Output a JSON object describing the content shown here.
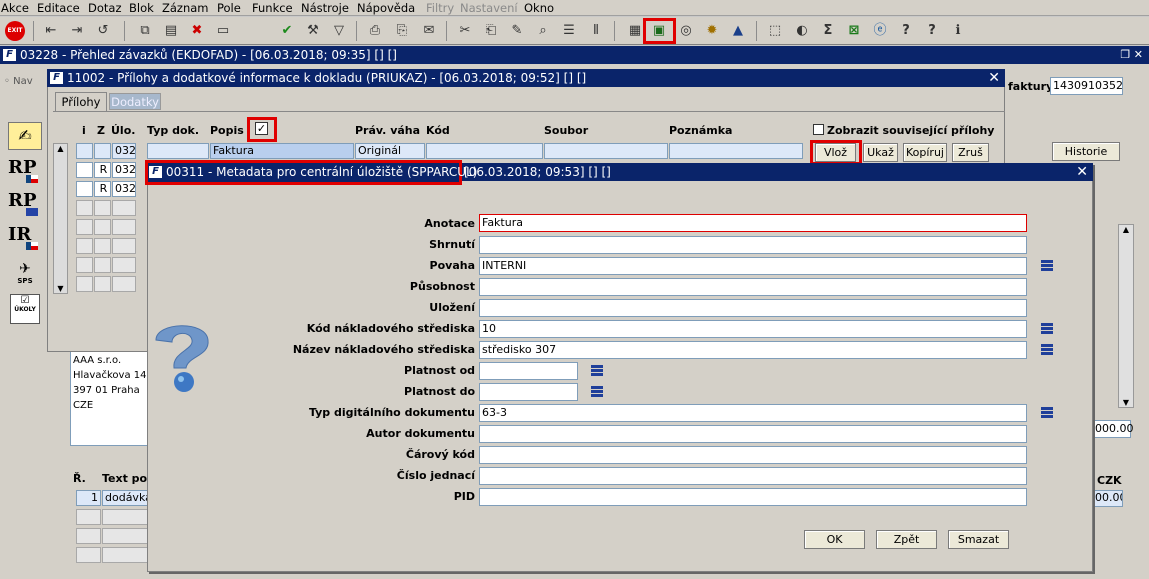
{
  "menu": [
    "Akce",
    "Editace",
    "Dotaz",
    "Blok",
    "Záznam",
    "Pole",
    "Funkce",
    "Nástroje",
    "Nápověda",
    "Filtry",
    "Nastavení",
    "Okno"
  ],
  "toolbar": {
    "exit_label": "EXIT"
  },
  "main_window": {
    "title": "03228 - Přehled závazků (EKDOFAD) - [06.03.2018; 09:35] [] []",
    "nav_label": "Nav",
    "faktury_label": "faktury",
    "faktury_value": "1430910352",
    "historie_label": "Historie",
    "amount": "000.00",
    "czk_label": "CZK",
    "row_amount": "00.00",
    "address": [
      "AAA s.r.o.",
      "Hlavačkova 14",
      "397 01 Praha",
      "CZE"
    ],
    "items_header": {
      "r": "Ř.",
      "text": "Text pol"
    },
    "items_row": {
      "r": "1",
      "text": "dodávka_"
    }
  },
  "sidebar": [
    "RP",
    "RP",
    "IR",
    "SPS",
    "ÚKOLY"
  ],
  "attach_window": {
    "title": "11002 - Přílohy a dodatkové informace k dokladu (PRIUKAZ) - [06.03.2018; 09:52] [] []",
    "tabs": [
      "Přílohy",
      "Dodatky"
    ],
    "columns": {
      "i": "i",
      "z": "Z",
      "ulo": "Úlo.",
      "typ": "Typ dok.",
      "popis": "Popis",
      "prav": "Práv. váha",
      "kod": "Kód",
      "soubor": "Soubor",
      "poznamka": "Poznámka"
    },
    "show_related": "Zobrazit související přílohy",
    "buttons": {
      "vloz": "Vlož",
      "ukaz": "Ukaž",
      "kopiruj": "Kopíruj",
      "zrus": "Zruš"
    },
    "rows": [
      {
        "z": "",
        "ulo": "032",
        "popis": "Faktura",
        "prav": "Originál"
      },
      {
        "z": "R",
        "ulo": "032"
      },
      {
        "z": "R",
        "ulo": "032"
      }
    ]
  },
  "meta_window": {
    "title": "00311 - Metadata pro centrální úložiště (SPPARCUL)",
    "title_rest": "[06.03.2018; 09:53] [] []",
    "fields": [
      {
        "label": "Anotace",
        "value": "Faktura"
      },
      {
        "label": "Shrnutí",
        "value": ""
      },
      {
        "label": "Povaha",
        "value": "INTERNI"
      },
      {
        "label": "Působnost",
        "value": ""
      },
      {
        "label": "Uložení",
        "value": ""
      },
      {
        "label": "Kód nákladového střediska",
        "value": "10"
      },
      {
        "label": "Název nákladového střediska",
        "value": "středisko 307"
      },
      {
        "label": "Platnost od",
        "value": ""
      },
      {
        "label": "Platnost do",
        "value": ""
      },
      {
        "label": "Typ digitálního dokumentu",
        "value": "63-3"
      },
      {
        "label": "Autor dokumentu",
        "value": ""
      },
      {
        "label": "Čárový kód",
        "value": ""
      },
      {
        "label": "Číslo jednací",
        "value": ""
      },
      {
        "label": "PID",
        "value": ""
      }
    ],
    "buttons": {
      "ok": "OK",
      "zpet": "Zpět",
      "smazat": "Smazat"
    }
  },
  "colors": {
    "title_bar": "#0a246a",
    "highlight": "#e00000",
    "field_border": "#7f9db9"
  }
}
